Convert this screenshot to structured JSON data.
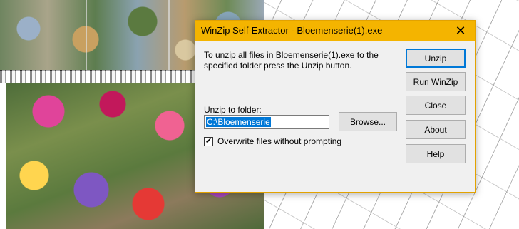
{
  "dialog": {
    "title": "WinZip Self-Extractor - Bloemenserie(1).exe",
    "message": "To unzip all files in Bloemenserie(1).exe to the specified folder press the Unzip button.",
    "folder_label": "Unzip to folder:",
    "folder_value": "C:\\Bloemenserie",
    "browse_label": "Browse...",
    "checkbox_label": "Overwrite files without prompting",
    "checkbox_checked": true,
    "checkbox_mark": "✔",
    "close_glyph": "✕",
    "buttons": {
      "unzip": "Unzip",
      "run_winzip": "Run WinZip",
      "close": "Close",
      "about": "About",
      "help": "Help"
    }
  },
  "colors": {
    "titlebar": "#f4b400",
    "selection": "#0078d7"
  }
}
